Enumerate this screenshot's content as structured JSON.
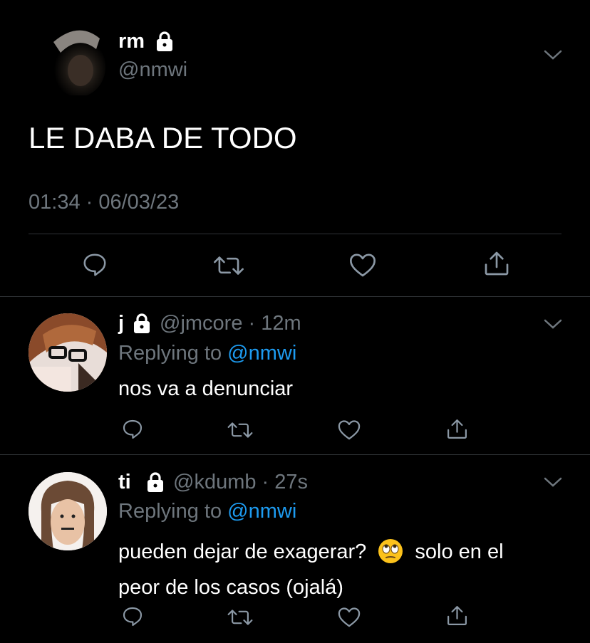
{
  "main_tweet": {
    "display_name": "rm",
    "handle": "@nmwi",
    "text": "LE DABA DE TODO",
    "timestamp": "01:34 · 06/03/23"
  },
  "replies": [
    {
      "display_name": "j",
      "handle": "@jmcore",
      "time": "· 12m",
      "replying_label": "Replying to",
      "replying_handle": "@nmwi",
      "text": "nos va a denunciar"
    },
    {
      "display_name": "ti",
      "handle": "@kdumb",
      "time": "· 27s",
      "replying_label": "Replying to",
      "replying_handle": "@nmwi",
      "text_line1_a": "pueden dejar de exagerar?",
      "text_line1_b": "solo en el",
      "text_line2": "peor de los casos (ojalá)"
    }
  ],
  "icons": {
    "reply": "reply-icon",
    "retweet": "retweet-icon",
    "like": "heart-icon",
    "share": "share-icon",
    "lock": "lock-icon",
    "more": "chevron-down-icon",
    "emoji": "eye-roll-emoji"
  },
  "colors": {
    "background": "#000000",
    "secondary_text": "#6e767d",
    "link": "#1d9bf0",
    "divider": "#2f3336"
  }
}
